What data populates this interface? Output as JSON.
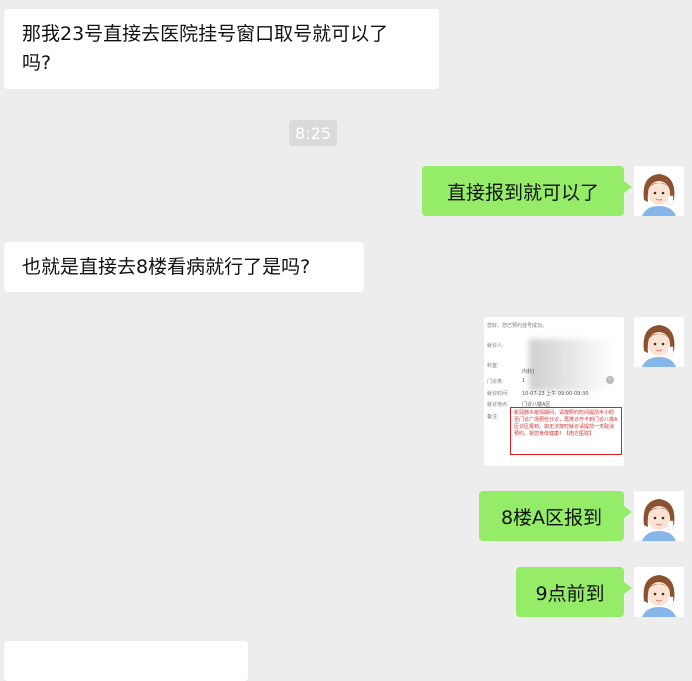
{
  "messages": {
    "m1": {
      "side": "left",
      "text_line1": "那我23号直接去医院挂号窗口取号就可以了",
      "text_line2": "吗?"
    },
    "timestamp": "8:25",
    "m2": {
      "side": "right",
      "text": "直接报到就可以了"
    },
    "m3": {
      "side": "left",
      "text": "也就是直接去8楼看病就行了是吗?"
    },
    "m4": {
      "side": "right",
      "type": "image",
      "card": {
        "header": "您好，您已预约挂号成功。",
        "row_patient_label": "就诊人:",
        "row_dept_label": "科室:",
        "row_dept_value": "内科]",
        "row_clinic_label": "门诊类:",
        "row_clinic_value": "1",
        "row_time_label": "就诊时间:",
        "row_time_value": "10-07-23 上午 09:00-09:30",
        "row_place_label": "就诊地点:",
        "row_place_value": "门诊八楼A区",
        "row_note_label": "备注:",
        "notice": "新冠肺炎疫情期间，请按照约时间提前半小时至门诊广场预检分诊，再携诊疗卡到门诊八楼A区诊区报到。如无法按时就诊请提前一天取消预约。祝您身体健康！【南方医院】"
      }
    },
    "m5": {
      "side": "right",
      "text": "8楼A区报到"
    },
    "m6": {
      "side": "right",
      "text": "9点前到"
    }
  },
  "avatar_icon": "cartoon-girl-avatar",
  "colors": {
    "background": "#ededed",
    "sent_bubble": "#95ec69",
    "received_bubble": "#ffffff",
    "notice_border": "#e02020"
  }
}
